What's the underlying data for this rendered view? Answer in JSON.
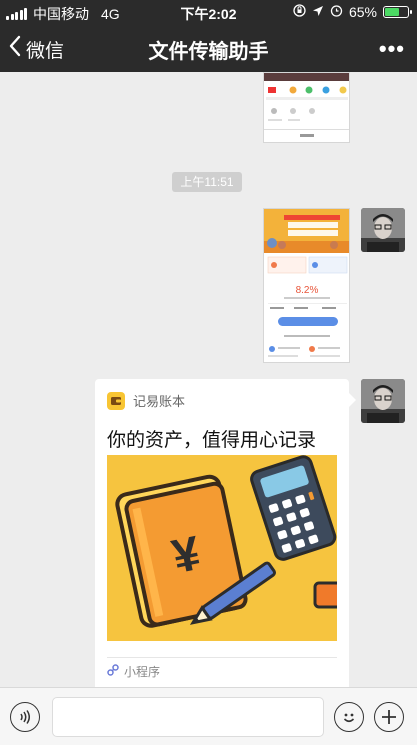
{
  "status_bar": {
    "carrier": "中国移动",
    "network": "4G",
    "time": "下午2:02",
    "battery": "65%",
    "battery_level": 0.65
  },
  "nav": {
    "back_label": "微信",
    "title": "文件传输助手",
    "more_icon": "ellipsis-icon"
  },
  "chat": {
    "timestamp": "上午11:51",
    "mini_program": {
      "app_name": "记易账本",
      "description": "你的资产，值得用心记录",
      "footer_label": "小程序"
    }
  },
  "input_bar": {
    "voice_icon": "voice-icon",
    "text_value": "",
    "emoji_icon": "emoji-icon",
    "add_icon": "plus-icon"
  },
  "colors": {
    "nav_bg": "#2b2b2b",
    "chat_bg": "#ededed",
    "cover_yellow": "#f6c43f",
    "book_orange": "#f49b32",
    "calculator_dark": "#3d4a5c"
  }
}
